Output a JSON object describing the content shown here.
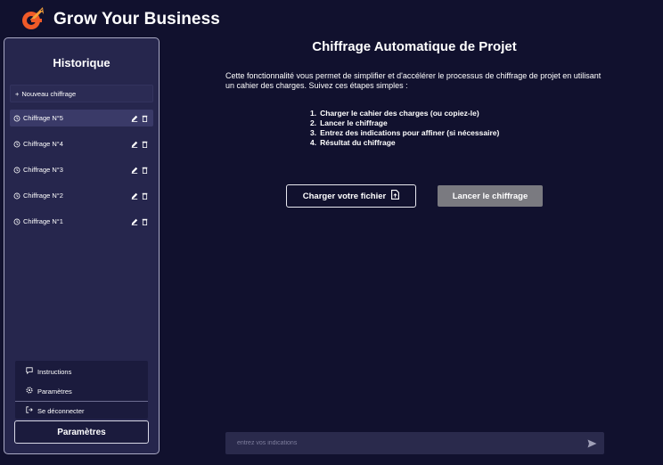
{
  "header": {
    "brand_title": "Grow Your Business",
    "logo_icon": "growth-flame-logo-icon"
  },
  "sidebar": {
    "title": "Historique",
    "new_quote": "Nouveau chiffrage",
    "history": [
      {
        "label": "Chiffrage N°5",
        "active": true
      },
      {
        "label": "Chiffrage N°4",
        "active": false
      },
      {
        "label": "Chiffrage N°3",
        "active": false
      },
      {
        "label": "Chiffrage N°2",
        "active": false
      },
      {
        "label": "Chiffrage N°1",
        "active": false
      }
    ],
    "bottom_menu": {
      "instructions": "Instructions",
      "settings": "Paramètres",
      "logout": "Se déconnecter"
    },
    "params_button": "Paramètres"
  },
  "main": {
    "title": "Chiffrage Automatique de Projet",
    "description": "Cette fonctionnalité vous permet de simplifier et d'accélérer le processus de chiffrage de projet en utilisant un cahier des charges. Suivez ces étapes simples :",
    "steps": [
      "Charger le cahier des charges (ou copiez-le)",
      "Lancer le chiffrage",
      "Entrez des indications pour affiner (si nécessaire)",
      "Résultat du chiffrage"
    ],
    "upload_button": "Charger votre fichier",
    "launch_button": "Lancer le chiffrage",
    "input": {
      "placeholder": "entrez vos indications",
      "value": ""
    }
  },
  "colors": {
    "background": "#11112e",
    "sidebar": "#26264d",
    "accent_orange": "#f05a28",
    "disabled_button": "#7a7a80"
  }
}
